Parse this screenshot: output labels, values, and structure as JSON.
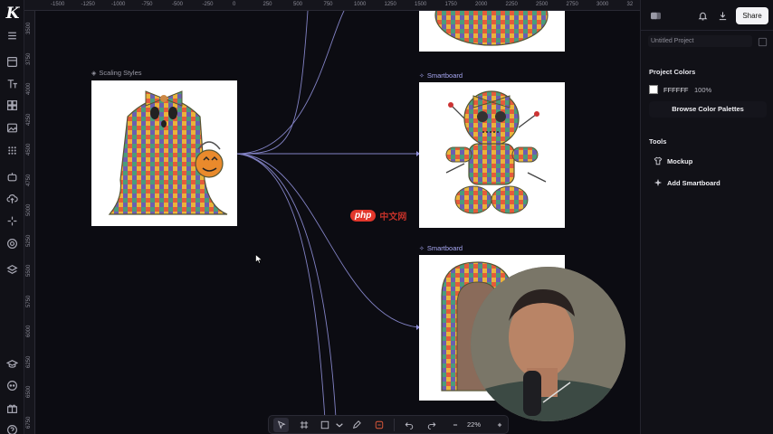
{
  "app": {
    "logo": "K"
  },
  "ruler": {
    "top": [
      "-1500",
      "-1250",
      "-1000",
      "-750",
      "-500",
      "-250",
      "0",
      "250",
      "500",
      "750",
      "1000",
      "1250",
      "1500",
      "1750",
      "2000",
      "2250",
      "2500",
      "2750",
      "3000",
      "32"
    ],
    "left": [
      "3500",
      "3750",
      "4000",
      "4250",
      "4500",
      "4750",
      "5000",
      "5250",
      "5500",
      "5750",
      "6000",
      "6250",
      "6500",
      "6750"
    ]
  },
  "canvas": {
    "source_label": "Scaling Styles",
    "smartboard_labels": [
      "Smartboard",
      "Smartboard"
    ],
    "frames": [
      {
        "name": "ghost-with-pumpkin",
        "alt": "Patchwork ghost with bow holding jack-o-lantern pail"
      },
      {
        "name": "patchwork-pumpkin",
        "alt": "Patchwork pumpkin"
      },
      {
        "name": "voodoo-doll",
        "alt": "Patchwork voodoo doll with pins"
      },
      {
        "name": "tombstone",
        "alt": "Patchwork tombstone"
      }
    ]
  },
  "right_panel": {
    "share_label": "Share",
    "project_name": "Untitled Project",
    "project_colors_title": "Project Colors",
    "color": {
      "hex": "FFFFFF",
      "opacity": "100%",
      "value": "#ffffff"
    },
    "browse_label": "Browse Color Palettes",
    "tools_title": "Tools",
    "tools": [
      {
        "label": "Mockup",
        "icon": "shirt-icon"
      },
      {
        "label": "Add Smartboard",
        "icon": "sparkle-icon"
      }
    ]
  },
  "bottom_toolbar": {
    "zoom": "22%"
  },
  "watermark": {
    "logo": "php",
    "text": "中文网"
  },
  "colors": {
    "accent_link": "#8f8fd8",
    "canvas_bg": "#0c0c12",
    "panel_bg": "#111117"
  }
}
